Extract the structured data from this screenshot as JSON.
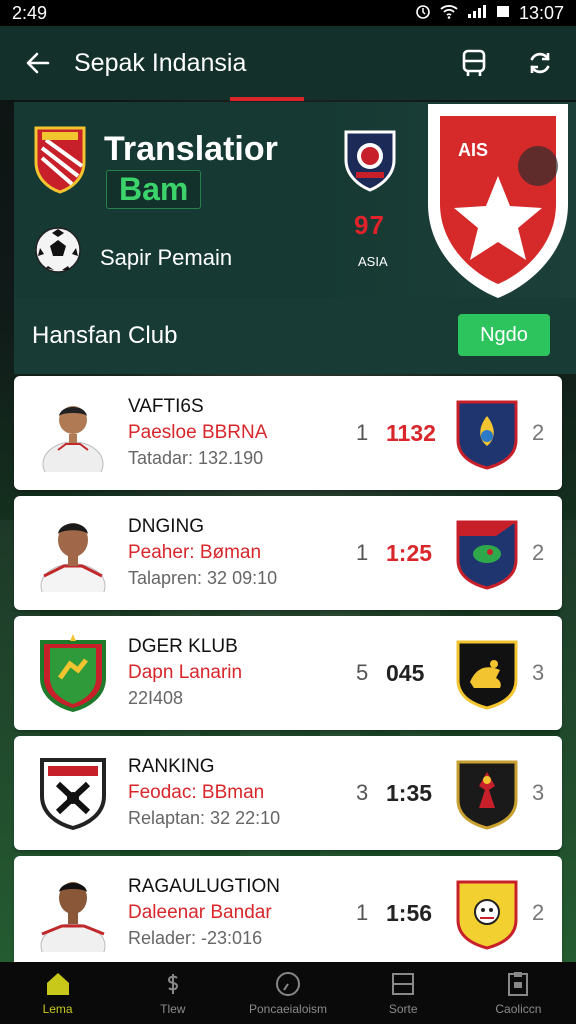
{
  "status_bar": {
    "time": "2:49",
    "right_text": "13:07"
  },
  "app_bar": {
    "title": "Sepak Indansia"
  },
  "hero": {
    "title": "Translatior",
    "badge": "Bam",
    "subtitle": "Sapir Pemain",
    "stat_value": "97",
    "stat_caption": "ASIA"
  },
  "section": {
    "title": "Hansfan Club",
    "button_label": "Ngdo"
  },
  "matches": [
    {
      "name": "VAFTI6S",
      "subtitle": "Paesloe BBRNA",
      "meta": "Tatadar: 132.190",
      "rank": "1",
      "score": "1132",
      "right": "2"
    },
    {
      "name": "DNGING",
      "subtitle": "Peaher: Bøman",
      "meta": "Talapren: 32 09:10",
      "rank": "1",
      "score": "1:25",
      "right": "2"
    },
    {
      "name": "DGER KLUB",
      "subtitle": "Dapn Lanarin",
      "meta": "22I408",
      "rank": "5",
      "score": "045",
      "right": "3"
    },
    {
      "name": "RANKING",
      "subtitle": "Feodac: BBman",
      "meta": "Relaptan: 32 22:10",
      "rank": "3",
      "score": "1:35",
      "right": "3"
    },
    {
      "name": "RAGAULUGTION",
      "subtitle": "Daleenar Bandar",
      "meta": "Relader: -23:016",
      "rank": "1",
      "score": "1:56",
      "right": "2"
    }
  ],
  "bottom_nav": [
    {
      "label": "Lema",
      "icon": "home-icon"
    },
    {
      "label": "Tlew",
      "icon": "dollar-icon"
    },
    {
      "label": "Poncaeialoism",
      "icon": "clock-icon"
    },
    {
      "label": "Sorte",
      "icon": "square-icon"
    },
    {
      "label": "Caoliccn",
      "icon": "clipboard-icon"
    }
  ],
  "colors": {
    "accent_red": "#d8262a",
    "accent_green": "#2ec45d",
    "nav_active": "#c8c81a"
  }
}
